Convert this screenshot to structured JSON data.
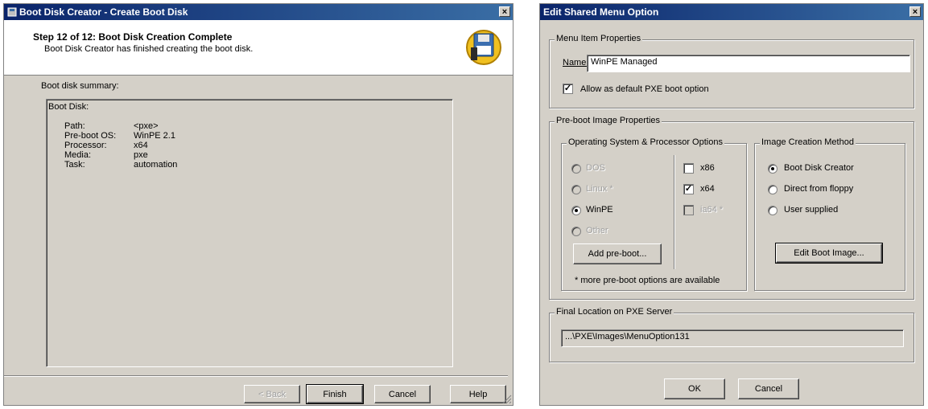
{
  "wizard": {
    "title": "Boot Disk Creator - Create Boot Disk",
    "step_title": "Step 12 of 12: Boot Disk Creation Complete",
    "step_subtitle": "Boot Disk Creator has finished creating the boot disk.",
    "summary_label": "Boot disk summary:",
    "box_heading": "Boot Disk:",
    "summary": [
      {
        "key": "Path:",
        "value": "<pxe>"
      },
      {
        "key": "Pre-boot OS:",
        "value": "WinPE 2.1"
      },
      {
        "key": "Processor:",
        "value": "x64"
      },
      {
        "key": "Media:",
        "value": "pxe"
      },
      {
        "key": "Task:",
        "value": "automation"
      }
    ],
    "buttons": {
      "back": "< Back",
      "finish": "Finish",
      "cancel": "Cancel",
      "help": "Help"
    },
    "close_glyph": "×"
  },
  "dialog": {
    "title": "Edit Shared Menu Option",
    "close_glyph": "×",
    "menu_item_group": "Menu Item Properties",
    "name_label": "Name:",
    "name_value": "WinPE Managed",
    "allow_default_label": "Allow as default PXE boot option",
    "allow_default_checked": true,
    "preboot_group": "Pre-boot Image Properties",
    "os_group": "Operating System & Processor Options",
    "os_options": [
      {
        "label": "DOS",
        "enabled": false,
        "selected": false
      },
      {
        "label": "Linux *",
        "enabled": false,
        "selected": false
      },
      {
        "label": "WinPE",
        "enabled": true,
        "selected": true
      },
      {
        "label": "Other",
        "enabled": false,
        "selected": false
      }
    ],
    "processors": [
      {
        "label": "x86",
        "enabled": true,
        "checked": false
      },
      {
        "label": "x64",
        "enabled": true,
        "checked": true
      },
      {
        "label": "ia64 *",
        "enabled": false,
        "checked": false
      }
    ],
    "add_preboot_label": "Add pre-boot...",
    "more_note": "* more pre-boot options are available",
    "method_group": "Image Creation Method",
    "methods": [
      {
        "label": "Boot Disk Creator",
        "selected": true
      },
      {
        "label": "Direct from floppy",
        "selected": false
      },
      {
        "label": "User supplied",
        "selected": false
      }
    ],
    "edit_boot_label": "Edit Boot Image...",
    "final_group": "Final Location on PXE Server",
    "final_path": "...\\PXE\\Images\\MenuOption131",
    "ok_label": "OK",
    "cancel_label": "Cancel"
  },
  "colors": {
    "title_start": "#0a246a",
    "title_end": "#3a6ea5",
    "face": "#d4d0c8"
  },
  "check_glyph": "✓"
}
